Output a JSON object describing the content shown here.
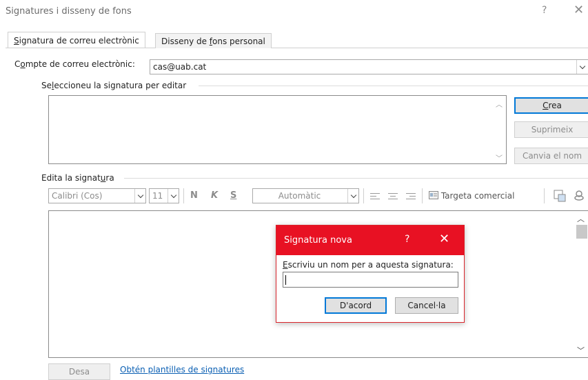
{
  "window": {
    "title": "Signatures i disseny de fons",
    "help_glyph": "?",
    "close_glyph": "✕"
  },
  "tabs": [
    {
      "label_pre": "",
      "label_accel": "S",
      "label_post": "ignatura de correu electrònic",
      "active": true
    },
    {
      "label_pre": "Disseny de ",
      "label_accel": "f",
      "label_post": "ons personal",
      "active": false
    }
  ],
  "account": {
    "label_pre": "C",
    "label_accel": "o",
    "label_post": "mpte de correu electrònic:",
    "value": "cas@uab.cat"
  },
  "select_signature": {
    "label_pre": "Se",
    "label_accel": "l",
    "label_post": "eccioneu la signatura per editar",
    "buttons": {
      "new_accel": "C",
      "new_post": "rea",
      "delete": "Suprimeix",
      "rename": "Canvia el nom"
    }
  },
  "edit_signature": {
    "label_pre": "Edita la signat",
    "label_accel": "u",
    "label_post": "ra",
    "toolbar": {
      "font": "Calibri (Cos)",
      "size": "11",
      "bold": "N",
      "italic": "K",
      "underline": "S",
      "color": "Automàtic",
      "business_card": "Targeta comercial"
    }
  },
  "footer": {
    "save": "Desa",
    "templates_link": "Obtén plantilles de signatures"
  },
  "dialog": {
    "title": "Signatura nova",
    "help_glyph": "?",
    "close_glyph": "✕",
    "prompt_accel": "E",
    "prompt_post": "scriviu un nom per a aquesta signatura:",
    "input_value": "",
    "ok": "D'acord",
    "cancel": "Cancel·la"
  },
  "colors": {
    "dialog_accent": "#e81123",
    "default_button_border": "#0078d7",
    "link": "#0a5fb3"
  }
}
